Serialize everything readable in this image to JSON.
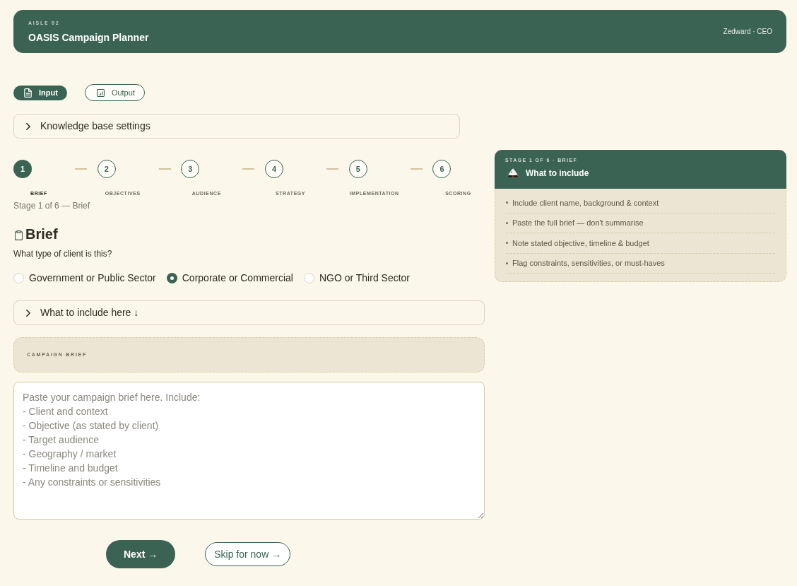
{
  "header": {
    "eyebrow": "AISLE 02",
    "title": "OASIS Campaign Planner",
    "user": "Zedward · CEO"
  },
  "mode_tabs": [
    {
      "label": "Input",
      "selected": true
    },
    {
      "label": "Output",
      "selected": false
    }
  ],
  "knowledge_base": {
    "label": "Knowledge base settings",
    "expanded": false
  },
  "stepper": {
    "steps": [
      {
        "number": "1",
        "label": "BRIEF",
        "selected": true
      },
      {
        "number": "2",
        "label": "OBJECTIVES",
        "selected": false
      },
      {
        "number": "3",
        "label": "AUDIENCE",
        "selected": false
      },
      {
        "number": "4",
        "label": "STRATEGY",
        "selected": false
      },
      {
        "number": "5",
        "label": "IMPLEMENTATION",
        "selected": false
      },
      {
        "number": "6",
        "label": "SCORING",
        "selected": false
      }
    ],
    "caption": "Stage 1 of 6 — Brief"
  },
  "section": {
    "title": "Brief",
    "question": "What type of client is this?",
    "client_types": [
      {
        "label": "Government or Public Sector",
        "selected": false
      },
      {
        "label": "Corporate or Commercial",
        "selected": true
      },
      {
        "label": "NGO or Third Sector",
        "selected": false
      }
    ]
  },
  "include_toggle": {
    "label": "What to include here ↓",
    "expanded": false
  },
  "brief_panel": {
    "label": "CAMPAIGN BRIEF"
  },
  "brief_field": {
    "placeholder": "Paste your campaign brief here. Include:\n- Client and context\n- Objective (as stated by client)\n- Target audience\n- Geography / market\n- Timeline and budget\n- Any constraints or sensitivities"
  },
  "actions": [
    {
      "label": "Next →",
      "kind": "primary"
    },
    {
      "label": "Skip for now →",
      "kind": "secondary"
    }
  ],
  "guide": {
    "eyebrow": "STAGE 1 OF 6 · BRIEF",
    "title": "What to include",
    "items": [
      "Include client name, background & context",
      "Paste the full brief — don't summarise",
      "Note stated objective, timeline & budget",
      "Flag constraints, sensitivities, or must-haves"
    ]
  }
}
